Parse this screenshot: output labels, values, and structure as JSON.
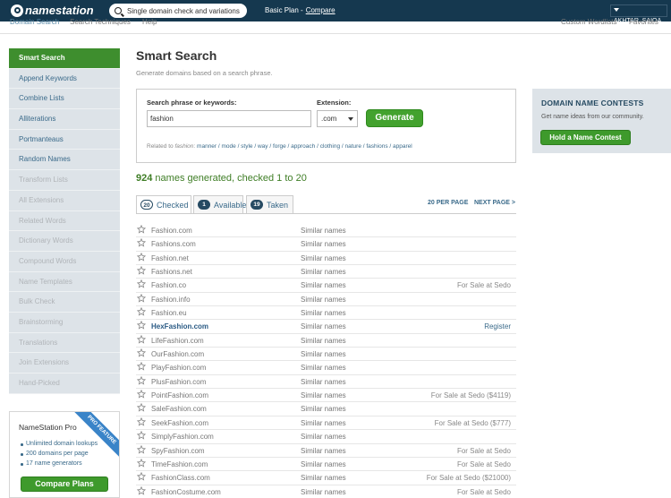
{
  "topbar": {
    "logo": "namestation",
    "search_text": "Single domain check and variations",
    "plan_label": "Basic Plan -",
    "plan_link": "Compare",
    "user": "AKHTAR_SAIQA"
  },
  "subnav": {
    "domain_search": "Domain Search",
    "search_techniques": "Search Techniques",
    "help": "Help",
    "custom_wordlists": "Custom Wordlists",
    "favorites": "Favorites"
  },
  "sidebar": {
    "items": [
      {
        "label": "Smart Search",
        "state": "active"
      },
      {
        "label": "Append Keywords",
        "state": "enabled"
      },
      {
        "label": "Combine Lists",
        "state": "enabled"
      },
      {
        "label": "Alliterations",
        "state": "enabled"
      },
      {
        "label": "Portmanteaus",
        "state": "enabled"
      },
      {
        "label": "Random Names",
        "state": "enabled"
      },
      {
        "label": "Transform Lists",
        "state": "disabled"
      },
      {
        "label": "All Extensions",
        "state": "disabled"
      },
      {
        "label": "Related Words",
        "state": "disabled"
      },
      {
        "label": "Dictionary Words",
        "state": "disabled"
      },
      {
        "label": "Compound Words",
        "state": "disabled"
      },
      {
        "label": "Name Templates",
        "state": "disabled"
      },
      {
        "label": "Bulk Check",
        "state": "disabled"
      },
      {
        "label": "Brainstorming",
        "state": "disabled"
      },
      {
        "label": "Translations",
        "state": "disabled"
      },
      {
        "label": "Join Extensions",
        "state": "disabled"
      },
      {
        "label": "Hand-Picked",
        "state": "disabled"
      }
    ]
  },
  "promo": {
    "title": "NameStation Pro",
    "ribbon": "PRO FEATURE",
    "features": [
      "Unlimited domain lookups",
      "200 domains per page",
      "17 name generators"
    ],
    "button": "Compare Plans"
  },
  "main": {
    "title": "Smart Search",
    "subtitle": "Generate domains based on a search phrase.",
    "phrase_label": "Search phrase or keywords:",
    "phrase_value": "fashion",
    "extension_label": "Extension:",
    "extension_value": ".com",
    "generate_button": "Generate",
    "related_prefix": "Related to",
    "related_term": "fashion",
    "related_words": "manner / mode / style / way / forge / approach / clothing / nature / fashions / apparel",
    "count_num": "924",
    "count_text": "names generated, checked 1 to 20"
  },
  "tabs": [
    {
      "count": "20",
      "label": "Checked"
    },
    {
      "count": "1",
      "label": "Available"
    },
    {
      "count": "19",
      "label": "Taken"
    }
  ],
  "pager": {
    "per_page": "20 PER PAGE",
    "next": "NEXT PAGE >"
  },
  "results": [
    {
      "domain": "Fashion.com",
      "similar": "Similar names",
      "status": ""
    },
    {
      "domain": "Fashions.com",
      "similar": "Similar names",
      "status": ""
    },
    {
      "domain": "Fashion.net",
      "similar": "Similar names",
      "status": ""
    },
    {
      "domain": "Fashions.net",
      "similar": "Similar names",
      "status": ""
    },
    {
      "domain": "Fashion.co",
      "similar": "Similar names",
      "status": "For Sale at Sedo"
    },
    {
      "domain": "Fashion.info",
      "similar": "Similar names",
      "status": ""
    },
    {
      "domain": "Fashion.eu",
      "similar": "Similar names",
      "status": ""
    },
    {
      "domain": "HexFashion.com",
      "similar": "Similar names",
      "status": "Register",
      "available": true
    },
    {
      "domain": "LifeFashion.com",
      "similar": "Similar names",
      "status": ""
    },
    {
      "domain": "OurFashion.com",
      "similar": "Similar names",
      "status": ""
    },
    {
      "domain": "PlayFashion.com",
      "similar": "Similar names",
      "status": ""
    },
    {
      "domain": "PlusFashion.com",
      "similar": "Similar names",
      "status": ""
    },
    {
      "domain": "PointFashion.com",
      "similar": "Similar names",
      "status": "For Sale at Sedo ($4119)"
    },
    {
      "domain": "SaleFashion.com",
      "similar": "Similar names",
      "status": ""
    },
    {
      "domain": "SeekFashion.com",
      "similar": "Similar names",
      "status": "For Sale at Sedo ($777)"
    },
    {
      "domain": "SimplyFashion.com",
      "similar": "Similar names",
      "status": ""
    },
    {
      "domain": "SpyFashion.com",
      "similar": "Similar names",
      "status": "For Sale at Sedo"
    },
    {
      "domain": "TimeFashion.com",
      "similar": "Similar names",
      "status": "For Sale at Sedo"
    },
    {
      "domain": "FashionClass.com",
      "similar": "Similar names",
      "status": "For Sale at Sedo ($21000)"
    },
    {
      "domain": "FashionCostume.com",
      "similar": "Similar names",
      "status": "For Sale at Sedo"
    }
  ],
  "contest": {
    "title": "DOMAIN NAME CONTESTS",
    "text": "Get name ideas from our community.",
    "button": "Hold a Name Contest"
  }
}
